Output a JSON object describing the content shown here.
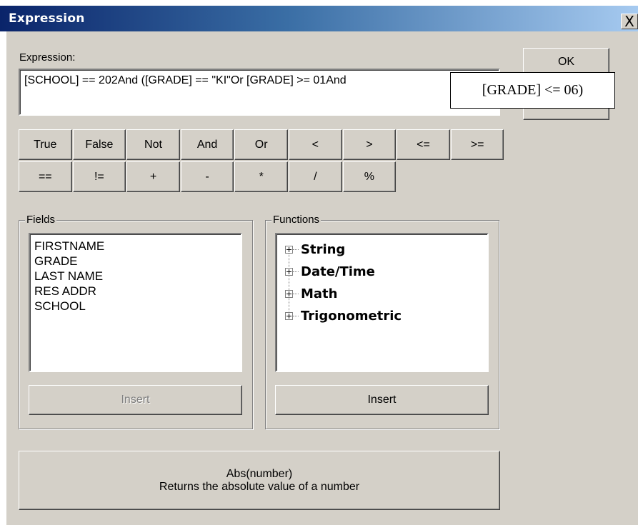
{
  "window": {
    "title": "Expression",
    "close_glyph": "X"
  },
  "expression": {
    "label": "Expression:",
    "value": "[SCHOOL] == 202And ([GRADE] == \"KI\"Or [GRADE] >= 01And"
  },
  "buttons": {
    "ok": "OK"
  },
  "operators": {
    "row1": [
      "True",
      "False",
      "Not",
      "And",
      "Or",
      "<",
      ">",
      "<=",
      ">="
    ],
    "row2": [
      "==",
      "!=",
      "+",
      "-",
      "*",
      "/",
      "%"
    ]
  },
  "fields": {
    "label": "Fields",
    "items": [
      "FIRSTNAME",
      "GRADE",
      "LAST NAME",
      "RES ADDR",
      "SCHOOL"
    ],
    "insert_label": "Insert"
  },
  "functions": {
    "label": "Functions",
    "items": [
      {
        "label": "String",
        "icon": "expand-plus-icon"
      },
      {
        "label": "Date/Time",
        "icon": "expand-plus-icon"
      },
      {
        "label": "Math",
        "icon": "expand-plus-icon"
      },
      {
        "label": "Trigonometric",
        "icon": "expand-plus-icon"
      }
    ],
    "insert_label": "Insert"
  },
  "description": {
    "signature": "Abs(number)",
    "text": "Returns the absolute value of a number"
  },
  "tooltip": {
    "text": "[GRADE] <= 06)"
  }
}
